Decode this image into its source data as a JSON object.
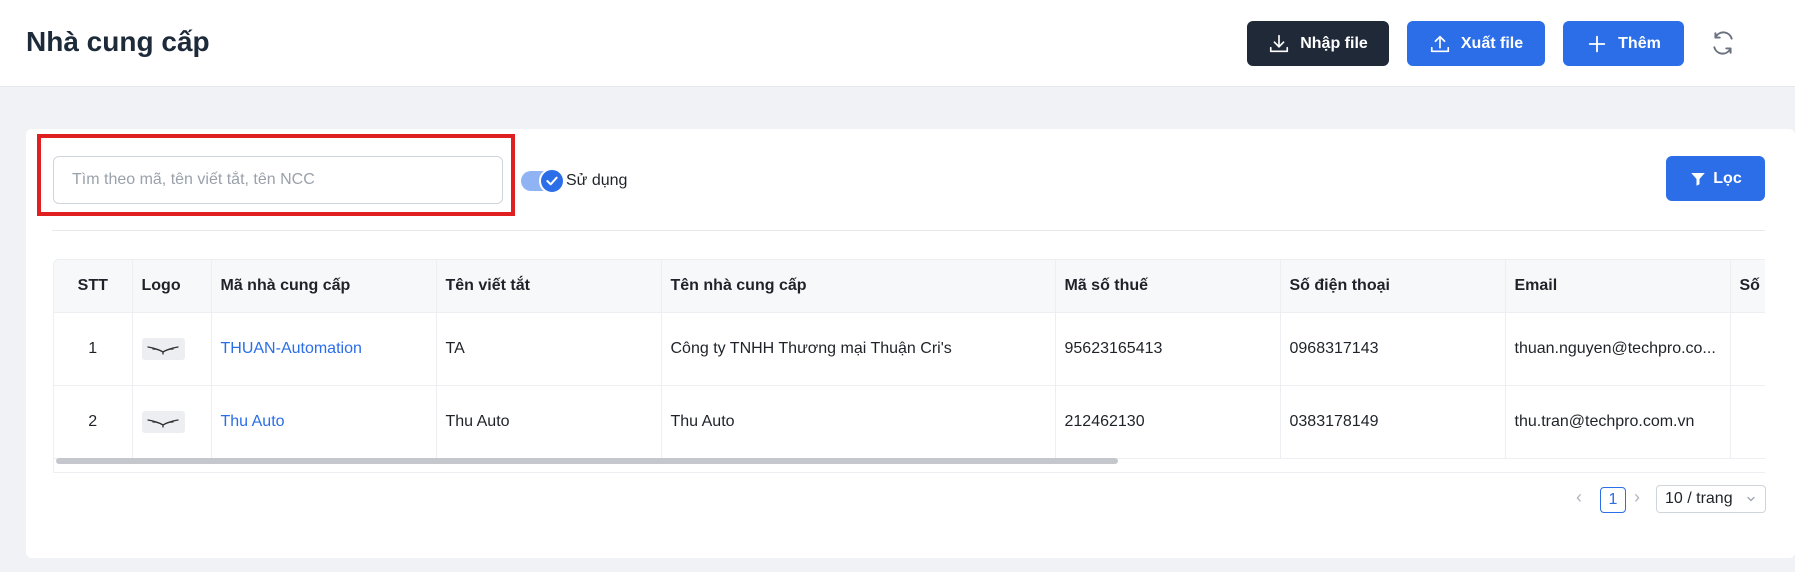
{
  "header": {
    "title": "Nhà cung cấp",
    "import_label": "Nhập file",
    "export_label": "Xuất file",
    "add_label": "Thêm",
    "icons": [
      "download-icon",
      "upload-icon",
      "plus-icon",
      "refresh-icon"
    ]
  },
  "filters": {
    "search_placeholder": "Tìm theo mã, tên viết tắt, tên NCC",
    "search_value": "",
    "toggle_label": "Sử dụng",
    "toggle_on": true,
    "filter_button_label": "Lọc"
  },
  "table": {
    "columns": [
      "STT",
      "Logo",
      "Mã nhà cung cấp",
      "Tên viết tắt",
      "Tên nhà cung cấp",
      "Mã số thuế",
      "Số điện thoại",
      "Email",
      "Số l"
    ],
    "rows": [
      {
        "stt": "1",
        "code": "THUAN-Automation",
        "short_name": "TA",
        "name": "Công ty TNHH Thương mại Thuận Cri's",
        "tax": "95623165413",
        "phone": "0968317143",
        "email": "thuan.nguyen@techpro.co..."
      },
      {
        "stt": "2",
        "code": "Thu Auto",
        "short_name": "Thu Auto",
        "name": "Thu Auto",
        "tax": "212462130",
        "phone": "0383178149",
        "email": "thu.tran@techpro.com.vn"
      }
    ]
  },
  "pagination": {
    "current_page": "1",
    "page_size": "10 / trang"
  },
  "colors": {
    "primary": "#2b6ee8",
    "dark_button": "#1f2937",
    "highlight": "#e02020"
  }
}
